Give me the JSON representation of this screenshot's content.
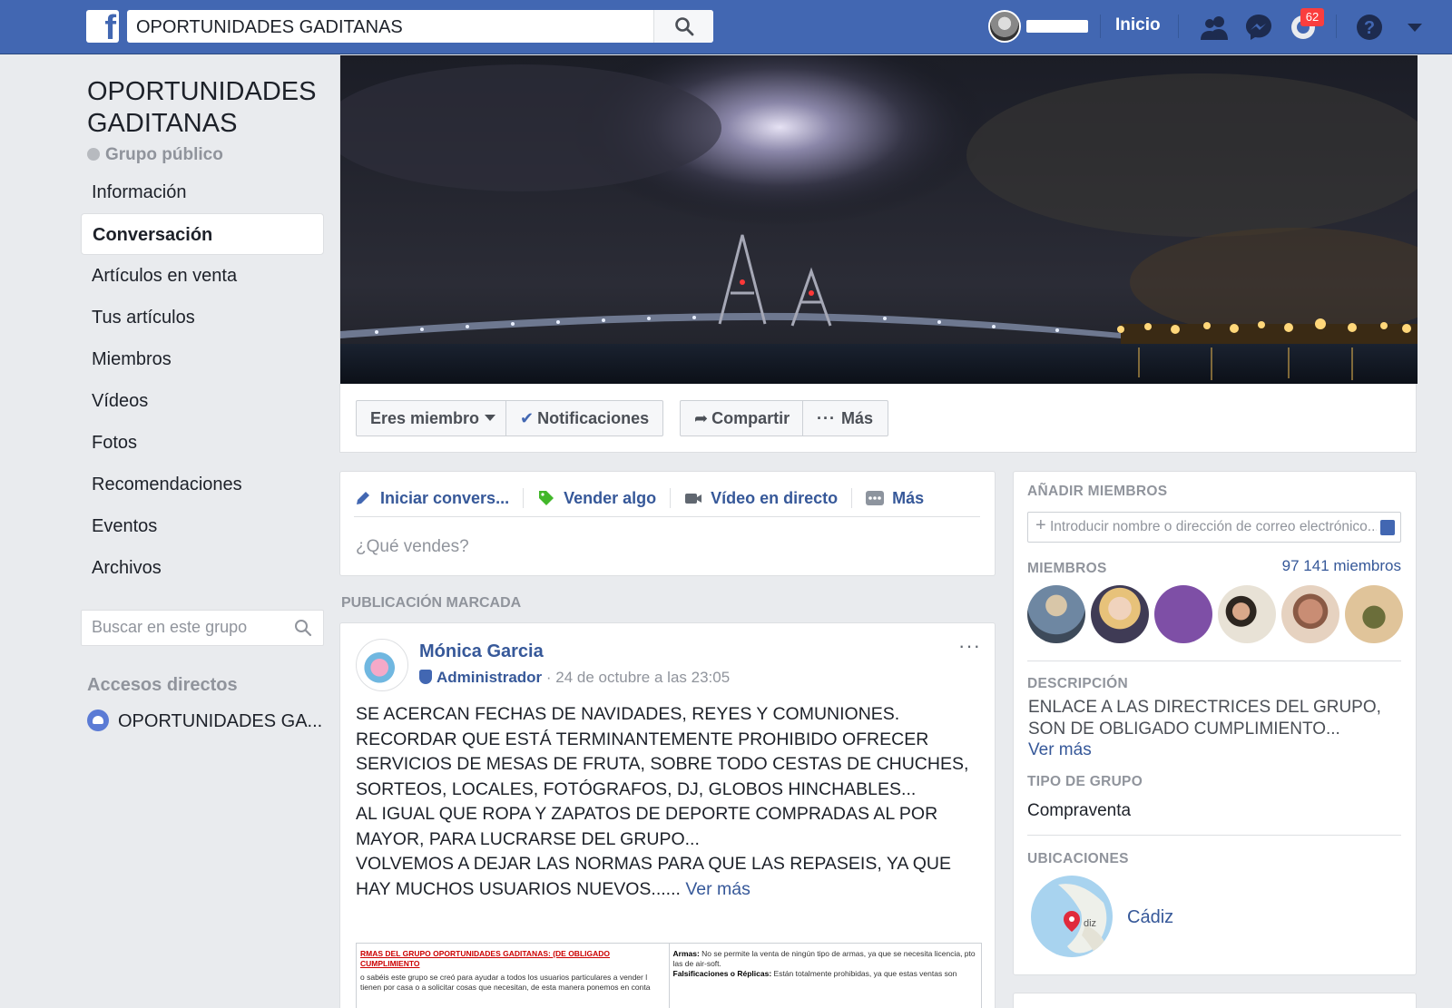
{
  "topbar": {
    "search_value": "OPORTUNIDADES GADITANAS",
    "home_label": "Inicio",
    "notifications_count": "62",
    "icons": [
      "facebook-logo-icon",
      "search-icon",
      "friends-icon",
      "messenger-icon",
      "notifications-icon",
      "help-icon",
      "chevron-down-icon"
    ],
    "accent_color": "#4267b2"
  },
  "group": {
    "title": "OPORTUNIDADES GADITANAS",
    "privacy": "Grupo público"
  },
  "nav": {
    "items": [
      "Información",
      "Conversación",
      "Artículos en venta",
      "Tus artículos",
      "Miembros",
      "Vídeos",
      "Fotos",
      "Recomendaciones",
      "Eventos",
      "Archivos"
    ],
    "active_index": 1
  },
  "group_search": {
    "placeholder": "Buscar en este grupo"
  },
  "shortcuts": {
    "title": "Accesos directos",
    "items": [
      "OPORTUNIDADES GA..."
    ]
  },
  "actions": {
    "member": "Eres miembro",
    "notifications": "Notificaciones",
    "share": "Compartir",
    "more": "Más"
  },
  "composer": {
    "tabs": [
      "Iniciar convers...",
      "Vender algo",
      "Vídeo en directo",
      "Más"
    ],
    "placeholder": "¿Qué vendes?"
  },
  "pinned": {
    "label": "PUBLICACIÓN MARCADA",
    "author": "Mónica Garcia",
    "role": "Administrador",
    "timestamp": "24 de octubre a las 23:05",
    "body": [
      "SE ACERCAN FECHAS DE NAVIDADES, REYES Y COMUNIONES.",
      "RECORDAR QUE ESTÁ TERMINANTEMENTE PROHIBIDO OFRECER SERVICIOS DE MESAS DE FRUTA, SOBRE TODO CESTAS DE CHUCHES, SORTEOS, LOCALES, FOTÓGRAFOS, DJ, GLOBOS HINCHABLES...",
      "AL IGUAL QUE ROPA Y ZAPATOS DE DEPORTE COMPRADAS AL POR MAYOR, PARA LUCRARSE DEL GRUPO...",
      "VOLVEMOS A DEJAR LAS NORMAS PARA QUE LAS REPASEIS, YA QUE HAY MUCHOS USUARIOS NUEVOS......"
    ],
    "see_more": "Ver más",
    "attachment": {
      "heading": "RMAS DEL GRUPO OPORTUNIDADES GADITANAS: (DE OBLIGADO CUMPLIMIENTO",
      "left_text": "o sabéis este grupo se creó para ayudar a todos los usuarios particulares a vender l tienen por casa o a solicitar cosas que necesitan, de esta manera ponemos en conta",
      "arms_label": "Armas:",
      "arms_text": "No se permite la venta de ningún tipo de armas, ya que se necesita licencia, pto las de air-soft.",
      "fakes_label": "Falsificaciones o Réplicas:",
      "fakes_text": "Están totalmente prohibidas, ya que estas ventas son"
    }
  },
  "sidebar": {
    "add_members": {
      "title": "AÑADIR MIEMBROS",
      "placeholder": "Introducir nombre o dirección de correo electrónico..."
    },
    "members": {
      "title": "MIEMBROS",
      "count": "97 141 miembros"
    },
    "description": {
      "title": "DESCRIPCIÓN",
      "text": "ENLACE A LAS DIRECTRICES DEL GRUPO, SON DE OBLIGADO CUMPLIMIENTO...",
      "more": "Ver más"
    },
    "group_type": {
      "title": "TIPO DE GRUPO",
      "value": "Compraventa"
    },
    "locations": {
      "title": "UBICACIONES",
      "city": "Cádiz",
      "map_label": "diz"
    }
  }
}
